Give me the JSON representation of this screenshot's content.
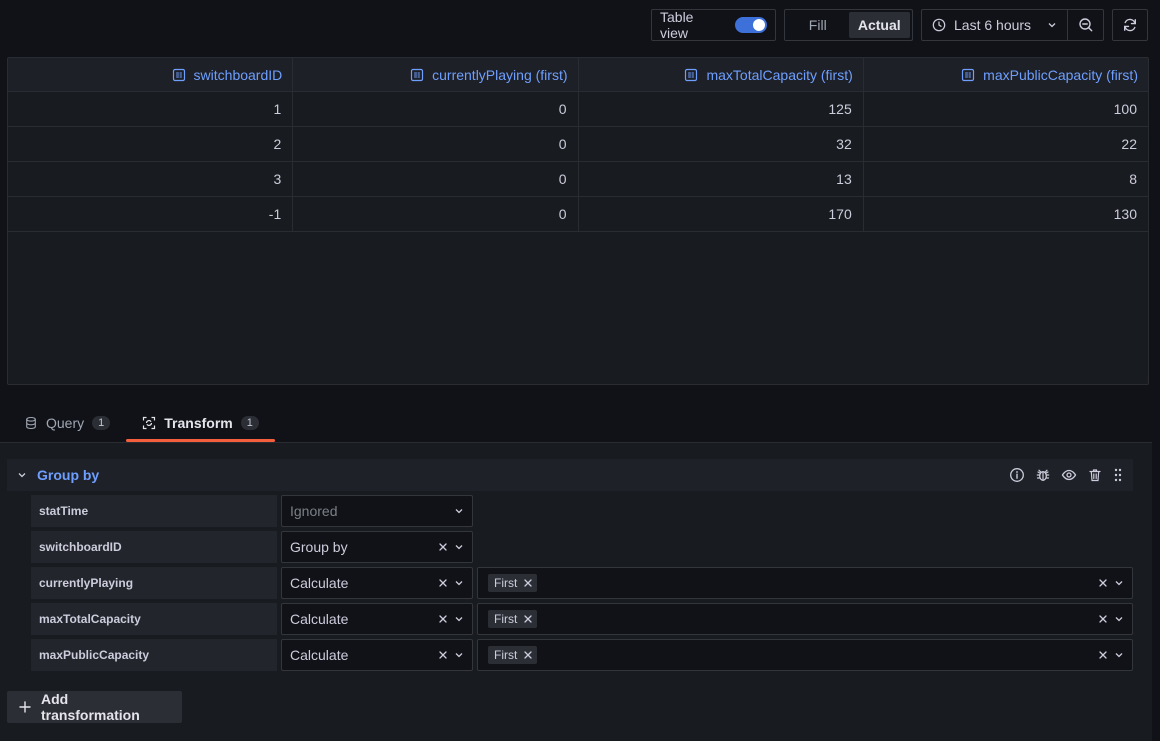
{
  "toolbar": {
    "table_view_label": "Table view",
    "table_view_on": true,
    "fill_label": "Fill",
    "actual_label": "Actual",
    "active_mode": "Actual",
    "time_range": "Last 6 hours"
  },
  "table": {
    "columns": [
      "switchboardID",
      "currentlyPlaying (first)",
      "maxTotalCapacity (first)",
      "maxPublicCapacity (first)"
    ],
    "rows": [
      [
        "1",
        "0",
        "125",
        "100"
      ],
      [
        "2",
        "0",
        "32",
        "22"
      ],
      [
        "3",
        "0",
        "13",
        "8"
      ],
      [
        "-1",
        "0",
        "170",
        "130"
      ]
    ]
  },
  "tabs": [
    {
      "label": "Query",
      "count": "1",
      "active": false
    },
    {
      "label": "Transform",
      "count": "1",
      "active": true
    }
  ],
  "transform": {
    "title": "Group by",
    "fields": [
      {
        "name": "statTime",
        "op": "Ignored",
        "placeholder": true,
        "calc": null
      },
      {
        "name": "switchboardID",
        "op": "Group by",
        "placeholder": false,
        "calc": null
      },
      {
        "name": "currentlyPlaying",
        "op": "Calculate",
        "placeholder": false,
        "calc": "First"
      },
      {
        "name": "maxTotalCapacity",
        "op": "Calculate",
        "placeholder": false,
        "calc": "First"
      },
      {
        "name": "maxPublicCapacity",
        "op": "Calculate",
        "placeholder": false,
        "calc": "First"
      }
    ],
    "add_label": "Add transformation"
  },
  "colors": {
    "accent_blue": "#6e9fff",
    "toggle_blue": "#3d71d9",
    "tab_underline": "#f55f3e"
  }
}
